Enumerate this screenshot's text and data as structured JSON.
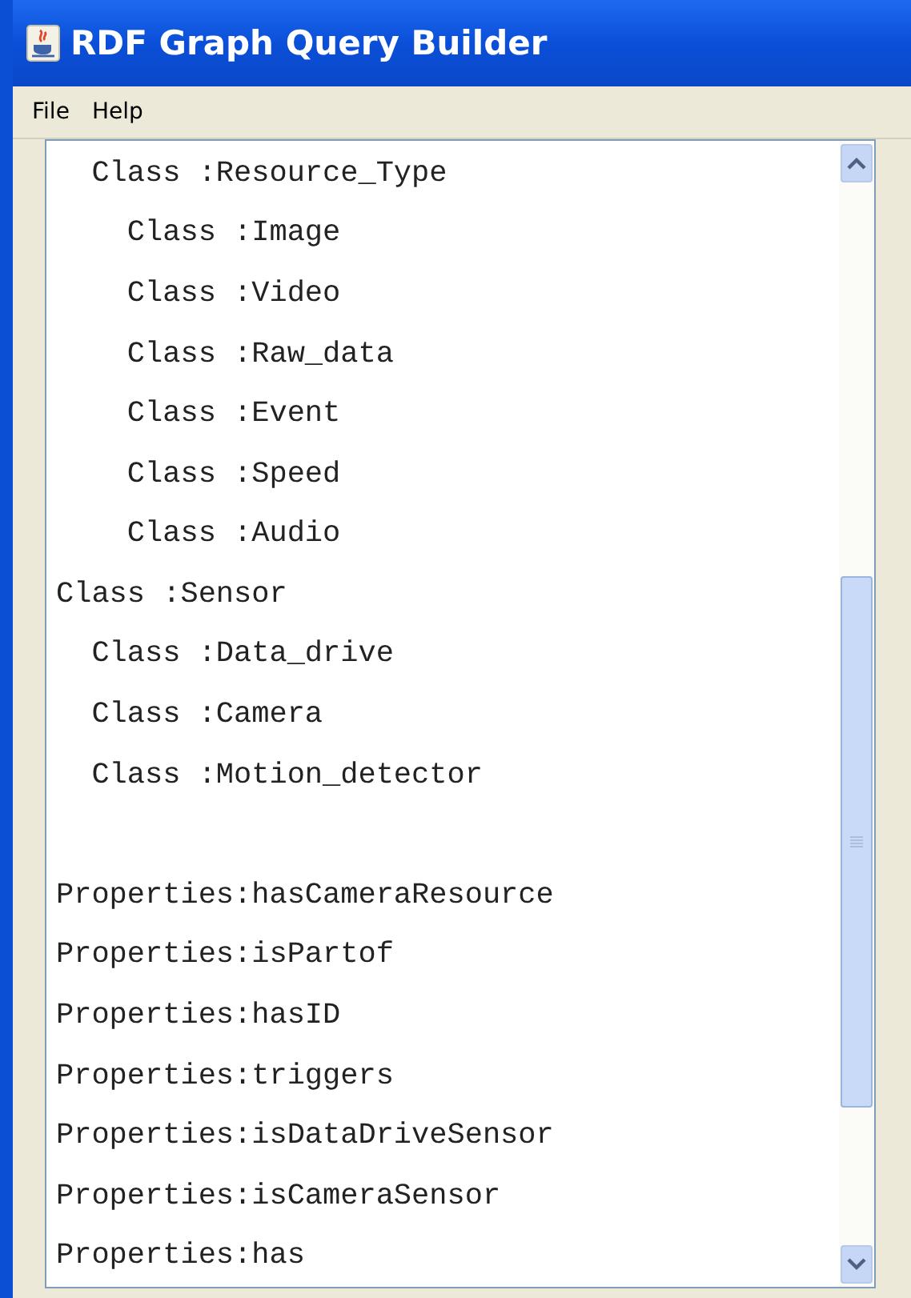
{
  "window": {
    "title": "RDF Graph Query Builder"
  },
  "menu": [
    "File",
    "Help"
  ],
  "tree": [
    {
      "children": [
        {
          "label": "Class :Resource_Type",
          "children": [
            {
              "label": "Class :Image"
            },
            {
              "label": "Class :Video"
            },
            {
              "label": "Class :Raw_data"
            },
            {
              "label": "Class :Event"
            },
            {
              "label": "Class :Speed"
            },
            {
              "label": "Class :Audio"
            }
          ]
        }
      ]
    },
    {
      "label": "Class :Sensor",
      "children": [
        {
          "label": "Class :Data_drive"
        },
        {
          "label": "Class :Camera"
        },
        {
          "label": "Class :Motion_detector"
        }
      ]
    }
  ],
  "properties": [
    "Properties:hasCameraResource",
    "Properties:isPartof",
    "Properties:hasID",
    "Properties:triggers",
    "Properties:isDataDriveSensor",
    "Properties:isCameraSensor",
    "Properties:has"
  ]
}
